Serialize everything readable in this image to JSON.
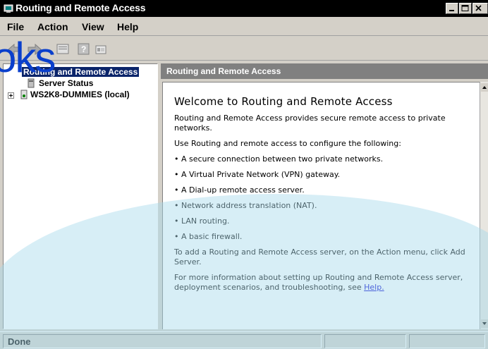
{
  "window": {
    "title": "Routing and Remote Access"
  },
  "menu": {
    "file": "File",
    "action": "Action",
    "view": "View",
    "help": "Help"
  },
  "overlay": {
    "text": "oks"
  },
  "tree": {
    "root_label": "Routing and Remote Access",
    "status_label": "Server Status",
    "server_label": "WS2K8-DUMMIES (local)"
  },
  "pane": {
    "header": "Routing and Remote Access",
    "welcome": "Welcome to Routing and Remote Access",
    "intro": "Routing and Remote Access provides secure remote access to private networks.",
    "use_line": "Use Routing and remote access to configure the following:",
    "bullets": [
      "• A secure connection between two private networks.",
      "• A Virtual Private Network (VPN) gateway.",
      "• A Dial-up remote access server.",
      "• Network address translation (NAT).",
      "• LAN routing.",
      "• A basic firewall."
    ],
    "add_server": "To add a Routing and Remote Access server, on the Action menu, click Add Server.",
    "more_info": "For more information about setting up Routing and Remote Access server, deployment scenarios, and troubleshooting, see",
    "help_link": "Help.",
    "help_link_suffix": ""
  },
  "status": {
    "text": "Done"
  },
  "colors": {
    "watermark": "#d6eef5",
    "overlay_text": "#0a3fcc",
    "selection": "#0a246a"
  },
  "icons": [
    "routing-icon",
    "back-arrow-icon",
    "forward-arrow-icon",
    "properties-icon",
    "help-icon",
    "console-icon",
    "server-icon",
    "status-icon"
  ]
}
